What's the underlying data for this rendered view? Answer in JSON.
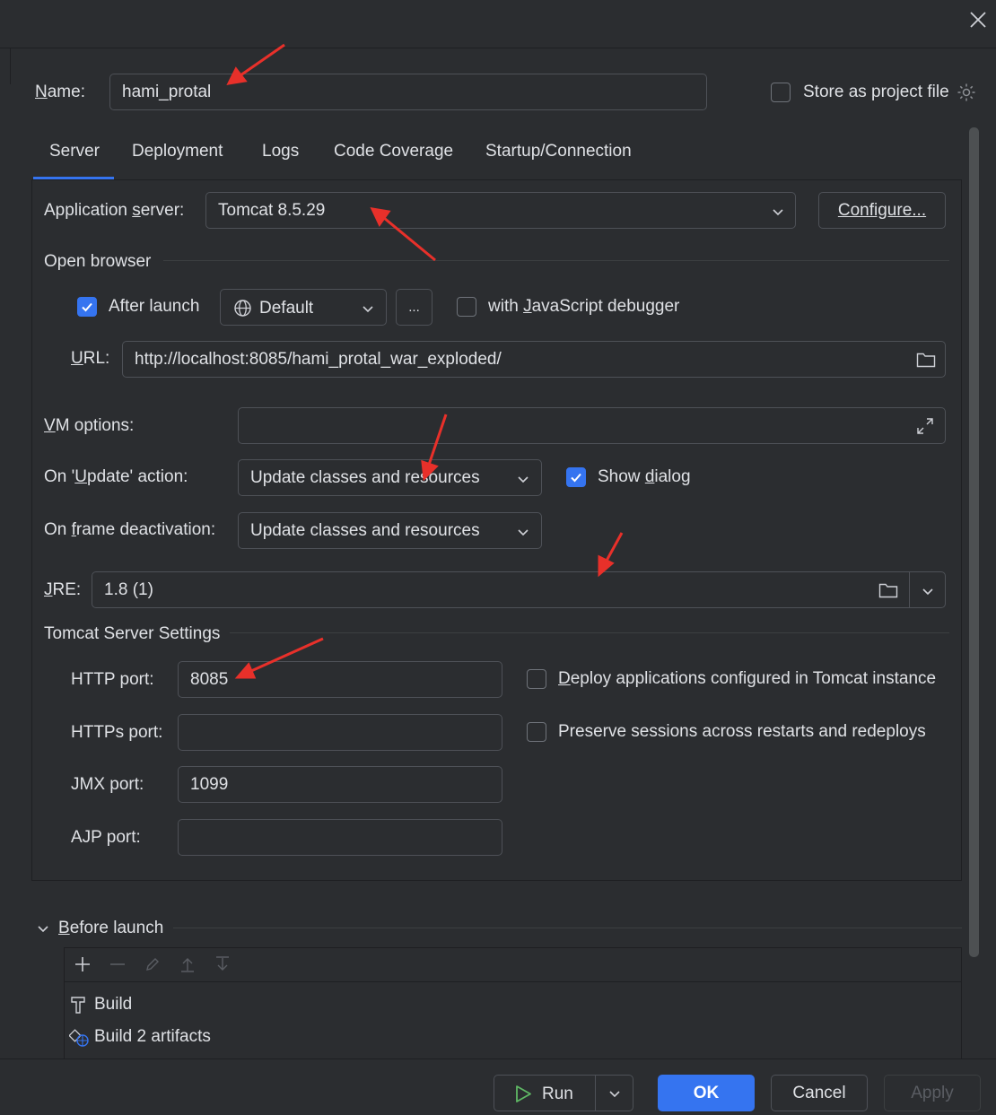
{
  "name_label": "Name:",
  "name_value": "hami_protal",
  "store_label": "Store as project file",
  "tabs": [
    "Server",
    "Deployment",
    "Logs",
    "Code Coverage",
    "Startup/Connection"
  ],
  "server": {
    "app_server_label": "Application server:",
    "app_server_value": "Tomcat 8.5.29",
    "configure_label": "Configure...",
    "open_browser_label": "Open browser",
    "after_launch_label": "After launch",
    "browser_value": "Default",
    "more_label": "...",
    "js_debugger_label": "with JavaScript debugger",
    "url_label": "URL:",
    "url_value": "http://localhost:8085/hami_protal_war_exploded/",
    "vm_options_label": "VM options:",
    "vm_options_value": "",
    "update_action_label": "On 'Update' action:",
    "update_action_value": "Update classes and resources",
    "show_dialog_label": "Show dialog",
    "frame_deactivation_label": "On frame deactivation:",
    "frame_deactivation_value": "Update classes and resources",
    "jre_label": "JRE:",
    "jre_value": "1.8 (1)",
    "tomcat_settings_label": "Tomcat Server Settings",
    "http_port_label": "HTTP port:",
    "http_port_value": "8085",
    "https_port_label": "HTTPs port:",
    "https_port_value": "",
    "jmx_port_label": "JMX port:",
    "jmx_port_value": "1099",
    "ajp_port_label": "AJP port:",
    "ajp_port_value": "",
    "deploy_apps_label": "Deploy applications configured in Tomcat instance",
    "preserve_sessions_label": "Preserve sessions across restarts and redeploys",
    "after_launch_checked": true,
    "js_debugger_checked": false,
    "show_dialog_checked": true,
    "deploy_apps_checked": false,
    "preserve_sessions_checked": false,
    "store_checked": false
  },
  "before_launch": {
    "label": "Before launch",
    "items": [
      "Build",
      "Build 2 artifacts"
    ]
  },
  "footer": {
    "run_label": "Run",
    "ok_label": "OK",
    "cancel_label": "Cancel",
    "apply_label": "Apply"
  },
  "colors": {
    "background": "#2b2d30",
    "accent": "#3574f0",
    "annotation_arrow": "#e8302a",
    "run_icon": "#5fb865"
  }
}
